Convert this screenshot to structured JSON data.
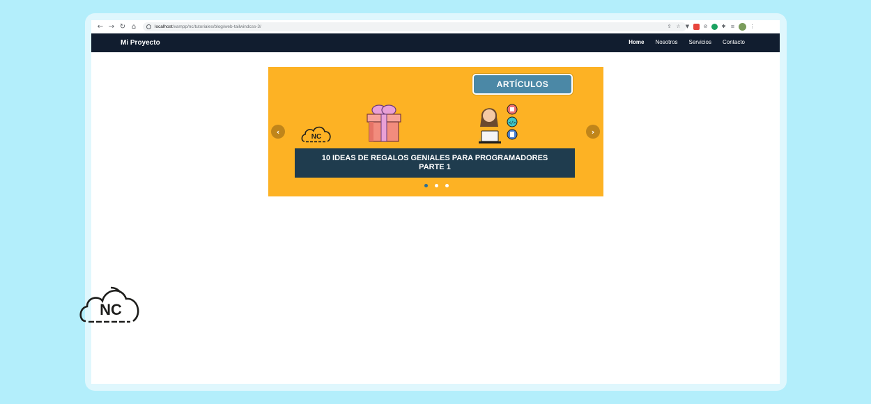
{
  "browser": {
    "url_host": "localhost",
    "url_path": "/xampp/nc/tutoriales/blog/web-tailwindcss-3/"
  },
  "site": {
    "brand": "Mi Proyecto",
    "menu": [
      {
        "label": "Home",
        "active": true
      },
      {
        "label": "Nosotros",
        "active": false
      },
      {
        "label": "Servicios",
        "active": false
      },
      {
        "label": "Contacto",
        "active": false
      }
    ]
  },
  "carousel": {
    "badge": "ARTÍCULOS",
    "caption_line1": "10 IDEAS DE REGALOS GENIALES PARA PROGRAMADORES",
    "caption_line2": "PARTE 1",
    "logo_text": "NC",
    "prev_arrow": "‹",
    "next_arrow": "›",
    "slide_count": 3,
    "active_slide": 1
  },
  "watermark": {
    "logo_text": "NC"
  },
  "colors": {
    "navbar": "#111d2f",
    "slide_bg": "#fdb224",
    "caption_bg": "#1f3c4e",
    "badge_bg": "#4b88a6"
  }
}
